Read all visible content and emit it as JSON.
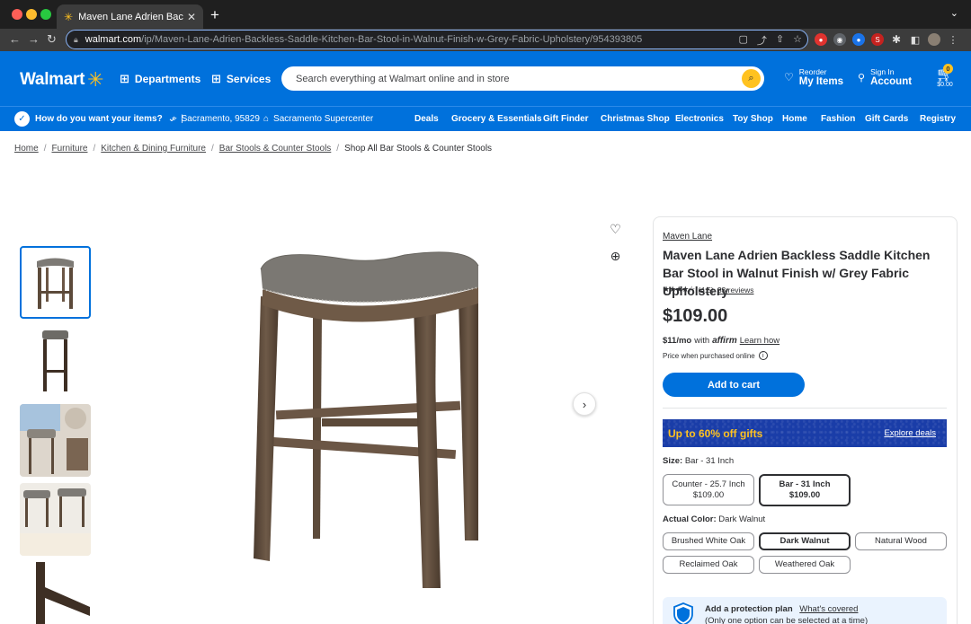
{
  "browser": {
    "tab_title": "Maven Lane Adrien Backless S",
    "url_host": "walmart.com",
    "url_path": "/ip/Maven-Lane-Adrien-Backless-Saddle-Kitchen-Bar-Stool-in-Walnut-Finish-w-Grey-Fabric-Upholstery/954393805"
  },
  "header": {
    "logo": "Walmart",
    "departments": "Departments",
    "services": "Services",
    "search_placeholder": "Search everything at Walmart online and in store",
    "reorder_small": "Reorder",
    "reorder_big": "My Items",
    "signin_small": "Sign In",
    "signin_big": "Account",
    "cart_count": "0",
    "cart_total": "$0.00"
  },
  "subnav": {
    "how": "How do you want your items?",
    "zip": "Sacramento, 95829",
    "store": "Sacramento Supercenter",
    "categories": [
      "Deals",
      "Grocery & Essentials",
      "Gift Finder",
      "Christmas Shop",
      "Electronics",
      "Toy Shop",
      "Home",
      "Fashion",
      "Gift Cards",
      "Registry"
    ]
  },
  "breadcrumb": [
    "Home",
    "Furniture",
    "Kitchen & Dining Furniture",
    "Bar Stools & Counter Stools"
  ],
  "breadcrumb_current": "Shop All Bar Stools & Counter Stools",
  "product": {
    "brand": "Maven Lane",
    "title": "Maven Lane Adrien Backless Saddle Kitchen Bar Stool in Walnut Finish w/ Grey Fabric Upholstery",
    "rating": "(4.5)",
    "reviews": "33 reviews",
    "price": "$109.00",
    "monthly": "$11/mo",
    "with": "with",
    "affirm": "affirm",
    "learn_how": "Learn how",
    "purchased_note": "Price when purchased online",
    "add_to_cart": "Add to cart",
    "promo": "Up to 60% off gifts",
    "promo_link": "Explore deals",
    "size_label": "Size:",
    "size_value": "Bar - 31 Inch",
    "sizes": [
      {
        "name": "Counter - 25.7 Inch",
        "price": "$109.00"
      },
      {
        "name": "Bar - 31 Inch",
        "price": "$109.00"
      }
    ],
    "color_label": "Actual Color:",
    "color_value": "Dark Walnut",
    "colors": [
      "Brushed White Oak",
      "Dark Walnut",
      "Natural Wood",
      "Reclaimed Oak",
      "Weathered Oak"
    ],
    "protect_title": "Add a protection plan",
    "protect_link": "What's covered",
    "protect_sub": "(Only one option can be selected at a time)"
  },
  "colors": {
    "brand_blue": "#0071dc",
    "spark_yellow": "#ffc220",
    "promo_blue": "#1a3da8"
  }
}
